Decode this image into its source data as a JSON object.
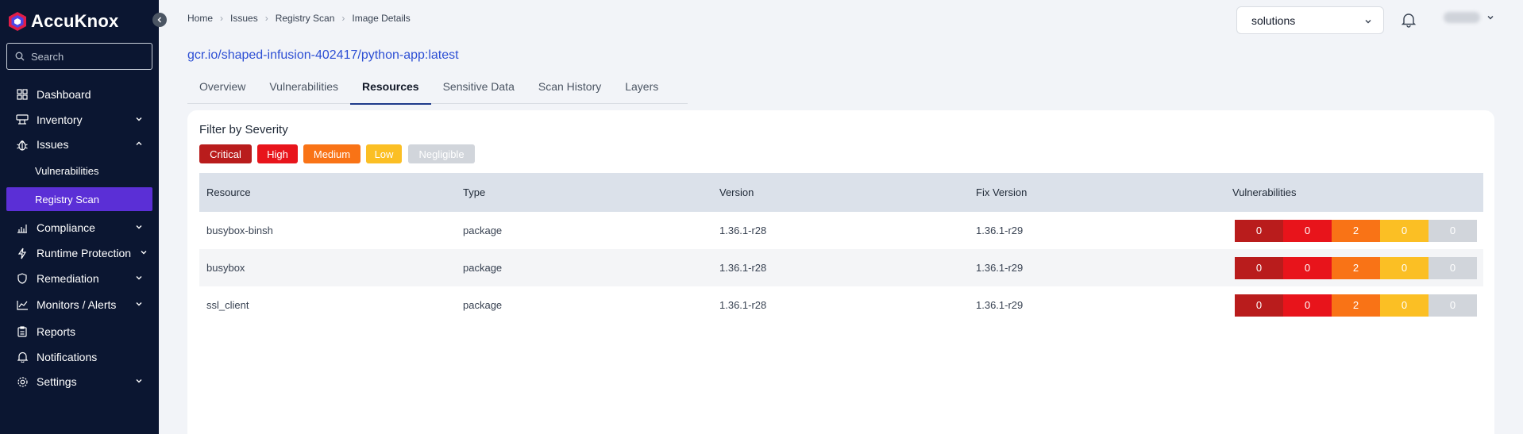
{
  "brand": {
    "name": "AccuKnox"
  },
  "sidebar": {
    "search_placeholder": "Search",
    "items": [
      {
        "label": "Dashboard"
      },
      {
        "label": "Inventory"
      },
      {
        "label": "Issues"
      },
      {
        "label": "Vulnerabilities"
      },
      {
        "label": "Registry Scan"
      },
      {
        "label": "Compliance"
      },
      {
        "label": "Runtime Protection"
      },
      {
        "label": "Remediation"
      },
      {
        "label": "Monitors / Alerts"
      },
      {
        "label": "Reports"
      },
      {
        "label": "Notifications"
      },
      {
        "label": "Settings"
      }
    ]
  },
  "breadcrumb": [
    "Home",
    "Issues",
    "Registry Scan",
    "Image Details"
  ],
  "tenant": {
    "selected": "solutions"
  },
  "page": {
    "image_name": "gcr.io/shaped-infusion-402417/python-app:latest"
  },
  "tabs": [
    "Overview",
    "Vulnerabilities",
    "Resources",
    "Sensitive Data",
    "Scan History",
    "Layers"
  ],
  "active_tab": "Resources",
  "filter": {
    "label": "Filter by Severity",
    "severities": [
      {
        "label": "Critical",
        "color": "#b91c1c"
      },
      {
        "label": "High",
        "color": "#e8141b"
      },
      {
        "label": "Medium",
        "color": "#f97316"
      },
      {
        "label": "Low",
        "color": "#fbbf24"
      },
      {
        "label": "Negligible",
        "color": "#d1d5db"
      }
    ]
  },
  "table": {
    "headers": [
      "Resource",
      "Type",
      "Version",
      "Fix Version",
      "Vulnerabilities"
    ],
    "rows": [
      {
        "resource": "busybox-binsh",
        "type": "package",
        "version": "1.36.1-r28",
        "fix_version": "1.36.1-r29",
        "vulns": [
          "0",
          "0",
          "2",
          "0",
          "0"
        ]
      },
      {
        "resource": "busybox",
        "type": "package",
        "version": "1.36.1-r28",
        "fix_version": "1.36.1-r29",
        "vulns": [
          "0",
          "0",
          "2",
          "0",
          "0"
        ]
      },
      {
        "resource": "ssl_client",
        "type": "package",
        "version": "1.36.1-r28",
        "fix_version": "1.36.1-r29",
        "vulns": [
          "0",
          "0",
          "2",
          "0",
          "0"
        ]
      }
    ]
  },
  "colors": {
    "sidebar_bg": "#0b1631",
    "active_nav": "#5b2fd6",
    "title_link": "#2d4fd4",
    "critical": "#b91c1c",
    "high": "#e8141b",
    "medium": "#f97316",
    "low": "#fbbf24",
    "negligible": "#d1d5db"
  }
}
